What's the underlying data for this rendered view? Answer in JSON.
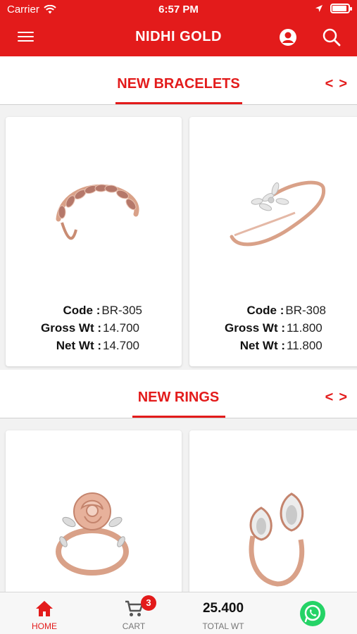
{
  "status": {
    "carrier": "Carrier",
    "time": "6:57 PM"
  },
  "header": {
    "title": "NIDHI GOLD"
  },
  "sections": [
    {
      "title": "NEW BRACELETS",
      "prev": "<",
      "next": ">",
      "products": [
        {
          "code_label": "Code :",
          "code": "BR-305",
          "gross_label": "Gross Wt :",
          "gross": "14.700",
          "net_label": "Net Wt :",
          "net": "14.700"
        },
        {
          "code_label": "Code :",
          "code": "BR-308",
          "gross_label": "Gross Wt :",
          "gross": "11.800",
          "net_label": "Net Wt :",
          "net": "11.800"
        }
      ]
    },
    {
      "title": "NEW RINGS",
      "prev": "<",
      "next": ">"
    }
  ],
  "tabbar": {
    "home_label": "HOME",
    "cart_label": "CART",
    "cart_count": "3",
    "total_value": "25.400",
    "total_label": "TOTAL WT"
  },
  "colors": {
    "brand": "#e31b1b",
    "gold": "#d9a188",
    "whatsapp": "#25d366"
  },
  "icons": [
    "menu-icon",
    "user-icon",
    "search-icon",
    "home-icon",
    "cart-icon",
    "whatsapp-icon",
    "wifi-icon",
    "location-arrow-icon",
    "battery-icon"
  ]
}
